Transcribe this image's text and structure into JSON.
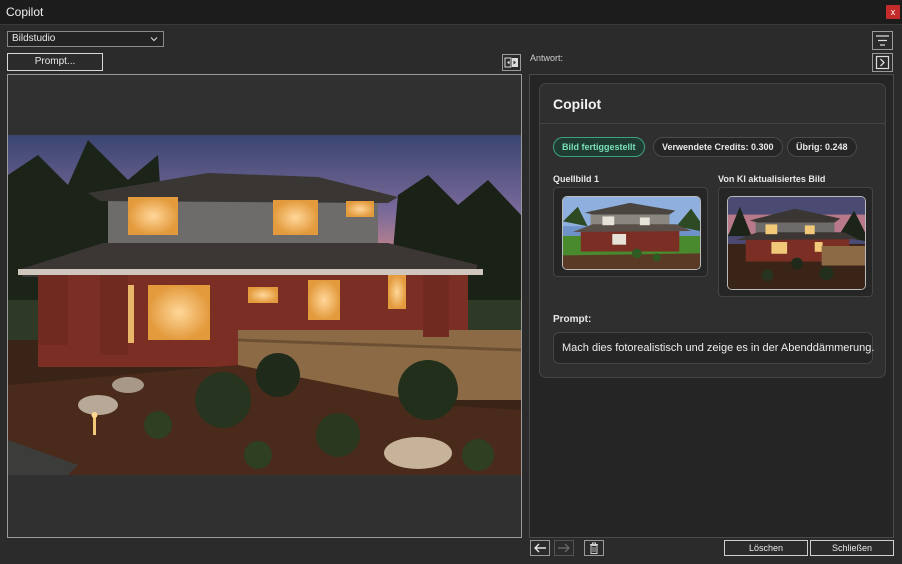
{
  "window": {
    "title": "Copilot",
    "close_glyph": "x"
  },
  "toolbar": {
    "dropdown_value": "Bildstudio",
    "prompt_button": "Prompt..."
  },
  "answer": {
    "label": "Antwort:",
    "card_title": "Copilot",
    "status_badge": "Bild fertiggestellt",
    "credits_badge": "Verwendete Credits: 0.300",
    "remaining_badge": "Übrig: 0.248",
    "source_label": "Quellbild 1",
    "result_label": "Von KI aktualisiertes Bild",
    "prompt_label": "Prompt:",
    "prompt_text": "Mach dies fotorealistisch und zeige es in der Abenddämmerung."
  },
  "footer": {
    "delete_button": "Löschen",
    "close_button": "Schließen"
  },
  "icons": [
    "chevron-down-icon",
    "compare-icon",
    "filter-icon",
    "panel-toggle-icon",
    "arrow-left-icon",
    "arrow-right-icon",
    "trash-icon",
    "close-icon"
  ],
  "colors": {
    "accent_green": "#3ea27f",
    "close_red": "#c42b2b",
    "background": "#2b2b2b"
  }
}
